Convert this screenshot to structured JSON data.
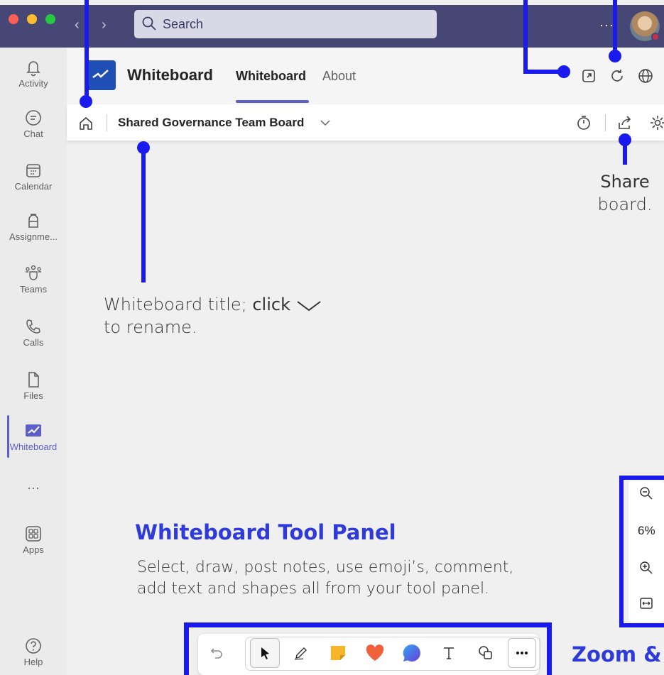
{
  "titlebar": {
    "search_placeholder": "Search",
    "more_label": "···"
  },
  "rail": {
    "items": [
      {
        "label": "Activity"
      },
      {
        "label": "Chat"
      },
      {
        "label": "Calendar"
      },
      {
        "label": "Assignme..."
      },
      {
        "label": "Teams"
      },
      {
        "label": "Calls"
      },
      {
        "label": "Files"
      },
      {
        "label": "Whiteboard"
      },
      {
        "label": "···"
      },
      {
        "label": "Apps"
      },
      {
        "label": "Help"
      }
    ]
  },
  "app": {
    "name": "Whiteboard",
    "tabs": [
      {
        "label": "Whiteboard"
      },
      {
        "label": "About"
      }
    ]
  },
  "board": {
    "title": "Shared Governance Team Board"
  },
  "annotations": {
    "share_bold": "Share",
    "share_rest": "board.",
    "title_prefix": "Whiteboard title; ",
    "title_click": "click",
    "title_rest": "to rename.",
    "tool_heading": "Whiteboard Tool Panel",
    "tool_desc_1": "Select, draw, post notes, use emoji’s, comment,",
    "tool_desc_2": "add text and shapes all from your tool panel.",
    "zoom_heading": "Zoom &"
  },
  "zoom": {
    "level": "6%"
  },
  "colors": {
    "accent": "#5b5fc7",
    "titlebar": "#464775",
    "annotation": "#1a1aee"
  }
}
